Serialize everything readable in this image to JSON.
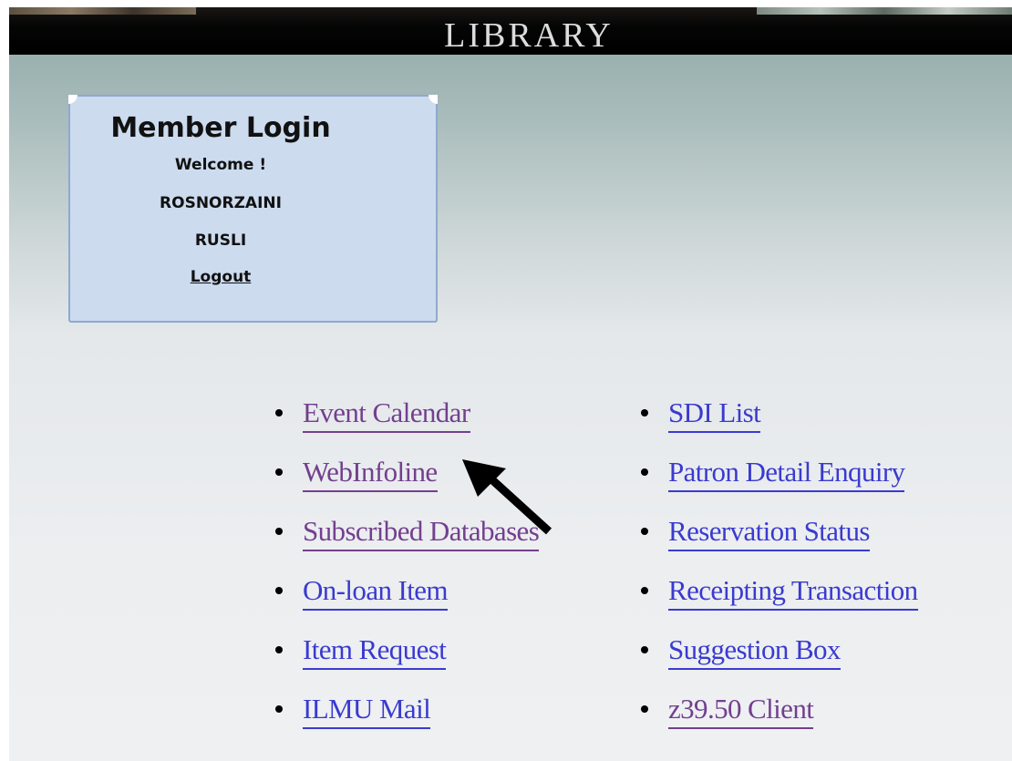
{
  "header": {
    "title": "LIBRARY"
  },
  "login": {
    "title": "Member Login",
    "welcome": "Welcome !",
    "name_line1": "ROSNORZAINI",
    "name_line2": "RUSLI",
    "logout_label": "Logout"
  },
  "links": {
    "left": [
      {
        "label": " Event Calendar"
      },
      {
        "label": " WebInfoline"
      },
      {
        "label": " Subscribed Databases"
      },
      {
        "label": " On-loan Item"
      },
      {
        "label": " Item Request"
      },
      {
        "label": " ILMU Mail"
      }
    ],
    "right": [
      {
        "label": " SDI List"
      },
      {
        "label": " Patron Detail Enquiry"
      },
      {
        "label": " Reservation Status"
      },
      {
        "label": " Receipting Transaction"
      },
      {
        "label": " Suggestion Box"
      },
      {
        "label": " z39.50 Client"
      }
    ]
  },
  "colors": {
    "link": "#3a3ad0",
    "visited_link": "#733f8f",
    "login_box_bg": "#ccdbee",
    "banner_bg": "#000000"
  },
  "annotation": {
    "icon": "arrow-icon",
    "points_to": "WebInfoline"
  }
}
